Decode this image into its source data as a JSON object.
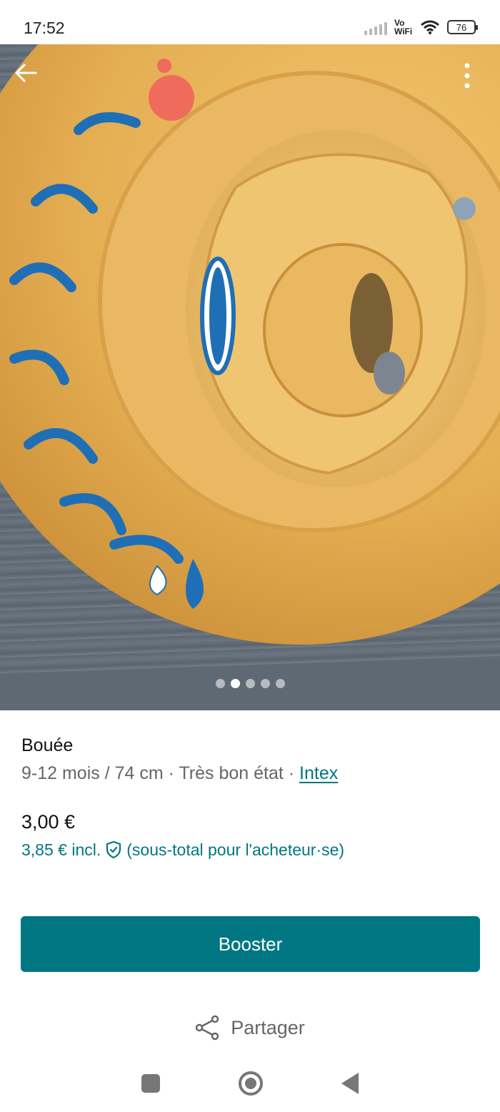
{
  "status": {
    "time": "17:52",
    "network": "Vo WiFi",
    "battery": "76"
  },
  "colors": {
    "brand": "#007782",
    "float": "#e8b75a",
    "logo_blue": "#1f6fb6"
  },
  "gallery": {
    "image_count": 5,
    "active_index": 1,
    "image_alt_text": "my baby float INTEX"
  },
  "product": {
    "title": "Bouée",
    "size": "9-12 mois / 74 cm",
    "separator": " · ",
    "condition": "Très bon état",
    "brand": "Intex",
    "price": "3,00 €",
    "price_incl": "3,85 € incl.",
    "price_note": "(sous-total pour l'acheteur·se)"
  },
  "actions": {
    "booster_label": "Booster",
    "share_label": "Partager"
  },
  "icons": [
    "back-arrow-icon",
    "more-vertical-icon",
    "shield-check-icon",
    "share-icon"
  ]
}
